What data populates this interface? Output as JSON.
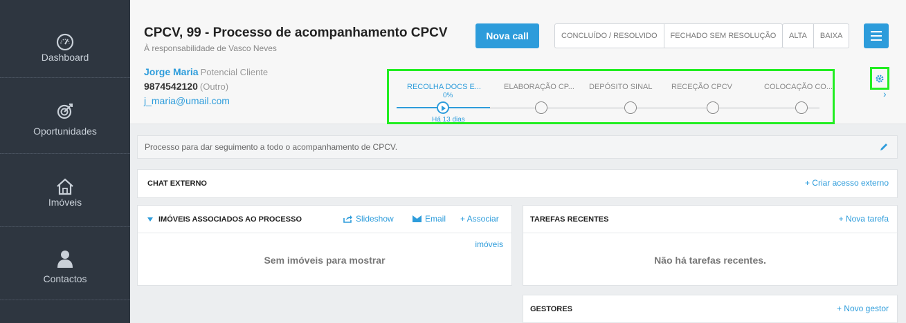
{
  "sidebar": {
    "items": [
      {
        "label": "Dashboard",
        "icon": "speedometer-icon"
      },
      {
        "label": "Oportunidades",
        "icon": "target-icon"
      },
      {
        "label": "Imóveis",
        "icon": "house-icon"
      },
      {
        "label": "Contactos",
        "icon": "person-icon"
      }
    ]
  },
  "header": {
    "title": "CPCV, 99 - Processo de acompanhamento CPCV",
    "subtitle": "À responsabilidade de Vasco Neves",
    "nova_call": "Nova call",
    "status_buttons": [
      "CONCLUÍDO / RESOLVIDO",
      "FECHADO SEM RESOLUÇÃO"
    ],
    "priority_buttons": [
      "ALTA",
      "BAIXA"
    ],
    "menu_icon": "hamburger-icon"
  },
  "contact": {
    "name": "Jorge Maria",
    "role": "Potencial Cliente",
    "phone": "9874542120",
    "phone_type": "(Outro)",
    "email": "j_maria@umail.com"
  },
  "pipeline": {
    "stages": [
      "RECOLHA DOCS E...",
      "ELABORAÇÃO CP...",
      "DEPÓSITO SINAL",
      "RECEÇÃO CPCV",
      "COLOCAÇÃO CO..."
    ],
    "active_index": 0,
    "active_percent": "0%",
    "active_time": "Há 13 dias",
    "gear_icon": "gear-icon",
    "next_icon": "chevron-right-icon"
  },
  "description": {
    "text": "Processo para dar seguimento a todo o acompanhamento de CPCV.",
    "edit_icon": "pencil-icon"
  },
  "chat_externo": {
    "title": "CHAT EXTERNO",
    "action": "+ Criar acesso externo"
  },
  "imoveis_panel": {
    "title": "IMÓVEIS ASSOCIADOS AO PROCESSO",
    "slideshow": "Slideshow",
    "email": "Email",
    "associar": "+ Associar",
    "associar_cont": "imóveis",
    "empty": "Sem imóveis para mostrar"
  },
  "tarefas_panel": {
    "title": "TAREFAS RECENTES",
    "action": "+ Nova tarefa",
    "empty": "Não há tarefas recentes."
  },
  "gestores_panel": {
    "title": "GESTORES",
    "action": "+ Novo gestor"
  },
  "colors": {
    "accent": "#2d9cdb",
    "sidebar": "#2e3640",
    "highlight": "#22ee22"
  }
}
